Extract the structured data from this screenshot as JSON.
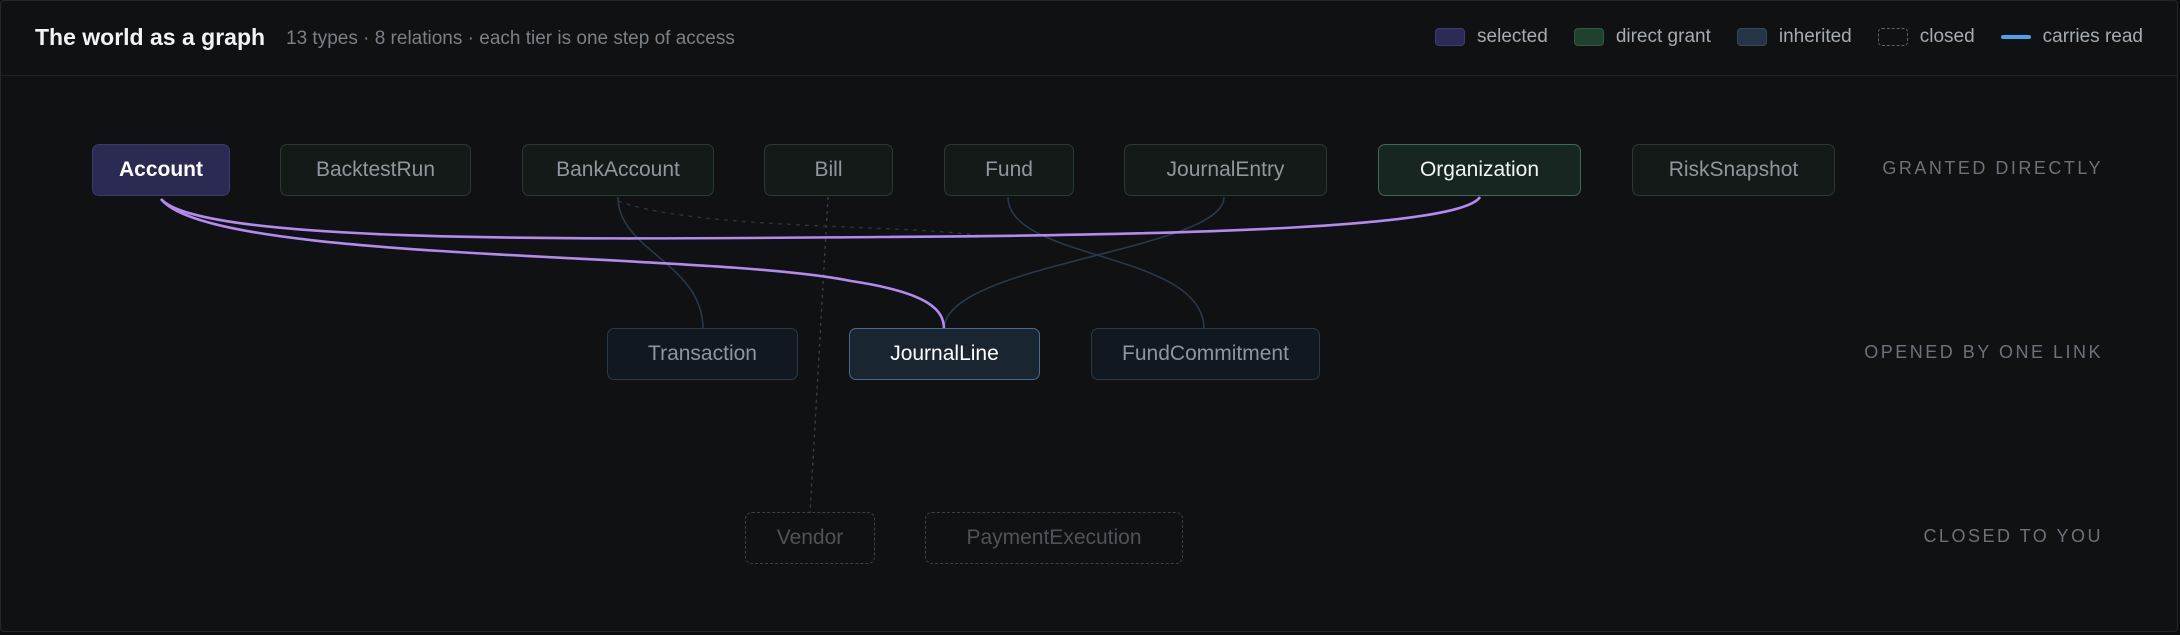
{
  "header": {
    "title": "The world as a graph",
    "subtitle": "13 types · 8 relations · each tier is one step of access"
  },
  "legend": [
    {
      "label": "selected"
    },
    {
      "label": "direct grant"
    },
    {
      "label": "inherited"
    },
    {
      "label": "closed"
    },
    {
      "label": "carries read"
    }
  ],
  "tiers": [
    {
      "label": "GRANTED DIRECTLY"
    },
    {
      "label": "OPENED BY ONE LINK"
    },
    {
      "label": "CLOSED TO YOU"
    }
  ],
  "nodes": {
    "account": {
      "label": "Account",
      "state": "selected"
    },
    "backtestrun": {
      "label": "BacktestRun",
      "state": "direct"
    },
    "bankaccount": {
      "label": "BankAccount",
      "state": "direct"
    },
    "bill": {
      "label": "Bill",
      "state": "direct"
    },
    "fund": {
      "label": "Fund",
      "state": "direct"
    },
    "journalentry": {
      "label": "JournalEntry",
      "state": "direct"
    },
    "organization": {
      "label": "Organization",
      "state": "direct-highlighted"
    },
    "risksnapshot": {
      "label": "RiskSnapshot",
      "state": "direct"
    },
    "transaction": {
      "label": "Transaction",
      "state": "inherited"
    },
    "journalline": {
      "label": "JournalLine",
      "state": "inherited-highlighted"
    },
    "fundcommitment": {
      "label": "FundCommitment",
      "state": "inherited"
    },
    "vendor": {
      "label": "Vendor",
      "state": "closed"
    },
    "paymentexecution": {
      "label": "PaymentExecution",
      "state": "closed"
    }
  },
  "colors": {
    "carries_read": "#b48af2",
    "legend_line": "#4ca2ea",
    "edge": "#2a3d4f",
    "closed_edge": "#3a3e44"
  }
}
